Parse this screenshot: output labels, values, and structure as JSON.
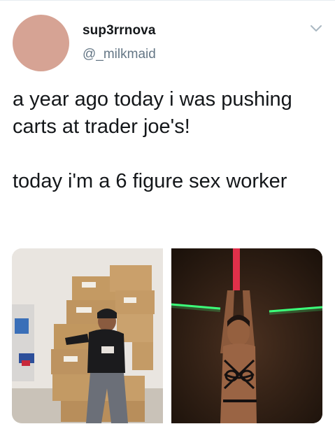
{
  "user": {
    "display_name": "sup3rrnova",
    "handle": "@_milkmaid"
  },
  "tweet": {
    "paragraph_1": "a year ago today i was pushing carts at trader joe's!",
    "paragraph_2": "today i'm a 6 figure sex worker"
  },
  "icons": {
    "menu": "chevron-down-icon"
  },
  "colors": {
    "text": "#14171a",
    "secondary_text": "#657786",
    "avatar": "#d6a394",
    "neon_green": "#3dff7a",
    "pole_red": "#e0304a"
  }
}
